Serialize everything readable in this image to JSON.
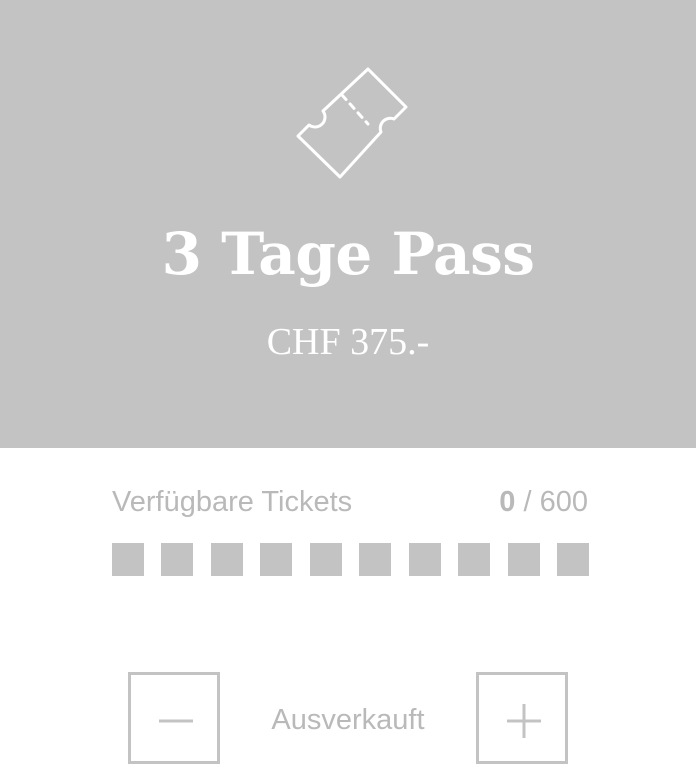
{
  "ticket": {
    "icon": "ticket-icon",
    "title": "3 Tage Pass",
    "price": "CHF 375.-"
  },
  "availability": {
    "label": "Verfügbare Tickets",
    "sold": "0",
    "separator": " / ",
    "total": "600",
    "remaining_fraction": 0,
    "blocks": 10
  },
  "quantity": {
    "minus_icon": "minus-icon",
    "plus_icon": "plus-icon",
    "status": "Ausverkauft"
  },
  "colors": {
    "hero_background": "#c3c3c3",
    "muted_text": "#b9b9b9",
    "hero_text": "#ffffff"
  }
}
